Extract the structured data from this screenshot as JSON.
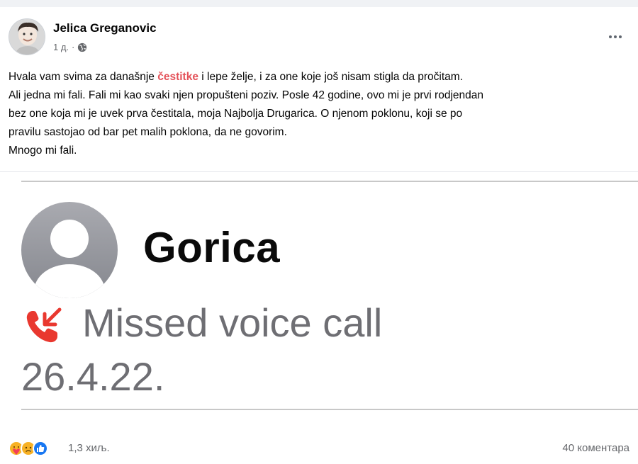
{
  "post": {
    "author": "Jelica Greganovic",
    "time": "1 д.",
    "privacy_icon": "globe-icon",
    "text_lines": [
      {
        "before": "Hvala vam svima za današnje ",
        "hashtag": "čestitke",
        "after": " i lepe želje, i za one koje još nisam stigla da pročitam."
      },
      "Ali jedna mi fali. Fali mi kao svaki njen propušteni poziv. Posle 42 godine, ovo mi je prvi rodjendan",
      "bez one koja mi je uvek prva čestitala, moja Najbolja Drugarica. O njenom poklonu, koji se po",
      "pravilu sastojao od bar pet malih poklona, da ne govorim.",
      "Mnogo mi fali."
    ]
  },
  "media": {
    "contact_name": "Gorica",
    "missed_call_label": "Missed voice call",
    "date": "26.4.22.",
    "missed_color": "#e9382f"
  },
  "footer": {
    "reaction_icons": [
      "care-emoji-icon",
      "sad-emoji-icon",
      "like-icon"
    ],
    "reaction_count": "1,3 хиљ.",
    "comments": "40 коментара"
  },
  "colors": {
    "hashtag": "#e4535a",
    "secondary_text": "#65676b",
    "like_blue": "#1877f2"
  }
}
